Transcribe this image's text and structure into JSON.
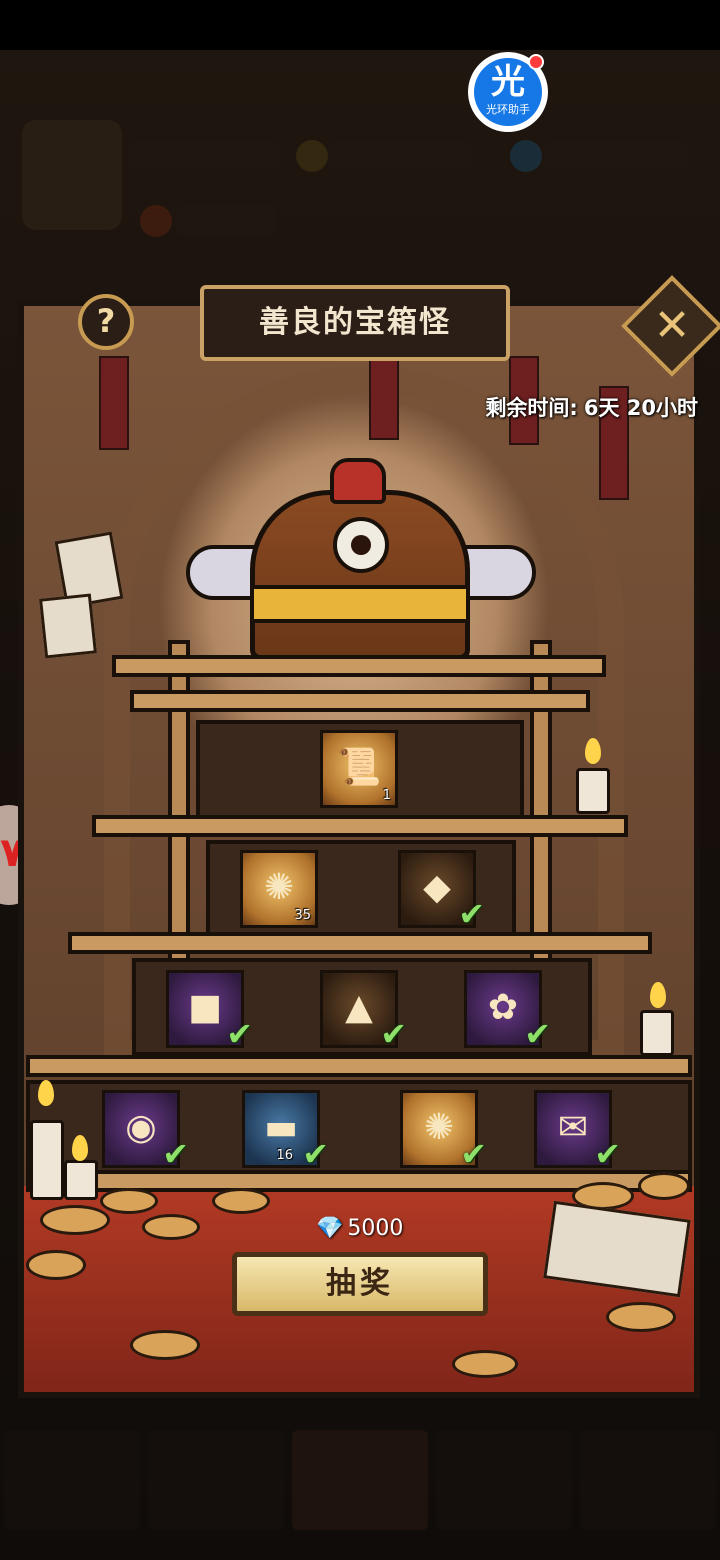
{
  "panel": {
    "title": "善良的宝箱怪",
    "remaining_label": "剩余时间:",
    "remaining_value": "6天 20小时"
  },
  "buttons": {
    "help": "?",
    "close": "✕",
    "draw": "抽奖"
  },
  "cost": {
    "currency_icon": "diamond-icon",
    "amount": "5000"
  },
  "overlay_app": {
    "glyph": "光",
    "label": "光环助手"
  },
  "rewards": [
    {
      "tier": 1,
      "icon": "scroll-letter-icon",
      "count": "1",
      "claimed": false
    },
    {
      "tier": 2,
      "icon": "golden-compass-icon",
      "count": "35",
      "claimed": false
    },
    {
      "tier": 2,
      "icon": "dark-crystal-chest-icon",
      "count": "",
      "claimed": true
    },
    {
      "tier": 3,
      "icon": "purple-cube-icon",
      "count": "",
      "claimed": true
    },
    {
      "tier": 3,
      "icon": "mystery-triangle-icon",
      "count": "",
      "claimed": true
    },
    {
      "tier": 3,
      "icon": "ribbon-charm-icon",
      "count": "",
      "claimed": true
    },
    {
      "tier": 4,
      "icon": "clock-amulet-icon",
      "count": "",
      "claimed": true
    },
    {
      "tier": 4,
      "icon": "iron-ingot-icon",
      "count": "16",
      "claimed": true
    },
    {
      "tier": 4,
      "icon": "bronze-compass-icon",
      "count": "",
      "claimed": true
    },
    {
      "tier": 4,
      "icon": "tied-scroll-icon",
      "count": "",
      "claimed": true
    }
  ],
  "colors": {
    "claimed_check": "#8fe06a",
    "title_border": "#caa266"
  }
}
